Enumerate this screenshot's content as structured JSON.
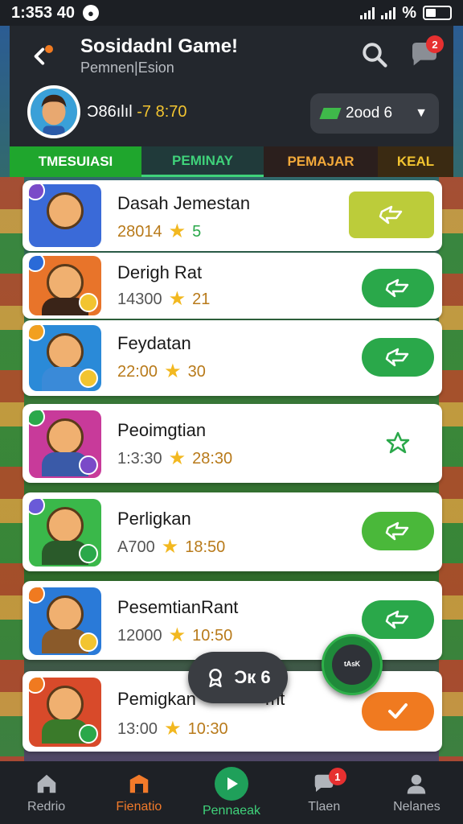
{
  "status_bar": {
    "time": "1:353 40",
    "battery_label": "%"
  },
  "header": {
    "title": "Sosidadnl Game!",
    "subtitle": "Pemnen|Esion",
    "chat_badge": "2",
    "player_id": "Ɔ86ılıl",
    "player_score": "-7 8:70",
    "currency_value": "2ood 6"
  },
  "tabs": [
    {
      "label": "TMESUIASI"
    },
    {
      "label": "PEMINAY"
    },
    {
      "label": "PEMAJAR"
    },
    {
      "label": "KEAL"
    }
  ],
  "games": [
    {
      "name": "Dasah Jemestan",
      "players": "28014",
      "rating": "5",
      "button_color": "#bccc3a",
      "thumb_color": "#3a6ad8",
      "corner_color": "#7a4ac8"
    },
    {
      "name": "Derigh Rat",
      "players": "14300",
      "rating": "21",
      "button_color": "#2aa84a",
      "thumb_color": "#e8742a",
      "corner_color": "#2a6ad8"
    },
    {
      "name": "Feydatan",
      "players": "22:00",
      "rating": "30",
      "button_color": "#2aa84a",
      "thumb_color": "#2a8ad8",
      "corner_color": "#f2a020"
    },
    {
      "name": "Peoimgtian",
      "players": "1:3:30",
      "rating": "28:30",
      "button_color": "#ffffff",
      "thumb_color": "#c83a9a",
      "corner_color": "#2aa84a"
    },
    {
      "name": "Perligkan",
      "players": "A700",
      "rating": "18:50",
      "button_color": "#4ab83a",
      "thumb_color": "#3ab84a",
      "corner_color": "#6a5ad8"
    },
    {
      "name": "PesemtianRant",
      "players": "12000",
      "rating": "10:50",
      "button_color": "#2aa84a",
      "thumb_color": "#2a7ad8",
      "corner_color": "#f07a20"
    },
    {
      "name": "Pemigkan",
      "name_suffix": "mt",
      "players": "13:00",
      "rating": "10:30",
      "button_color": "#f07a20",
      "thumb_color": "#d84a2a",
      "corner_color": "#f07a20"
    }
  ],
  "floating_pill": {
    "text": "Ɔк 6"
  },
  "fab": {
    "text": "ᵗᴬˢᴷ"
  },
  "bottom_nav": [
    {
      "label": "Redrio",
      "icon": "home-icon"
    },
    {
      "label": "Fienatio",
      "icon": "shop-icon"
    },
    {
      "label": "Pennaeak",
      "icon": "play-icon"
    },
    {
      "label": "Tlaen",
      "icon": "chat-icon",
      "badge": "1"
    },
    {
      "label": "Nelanes",
      "icon": "profile-icon"
    }
  ]
}
